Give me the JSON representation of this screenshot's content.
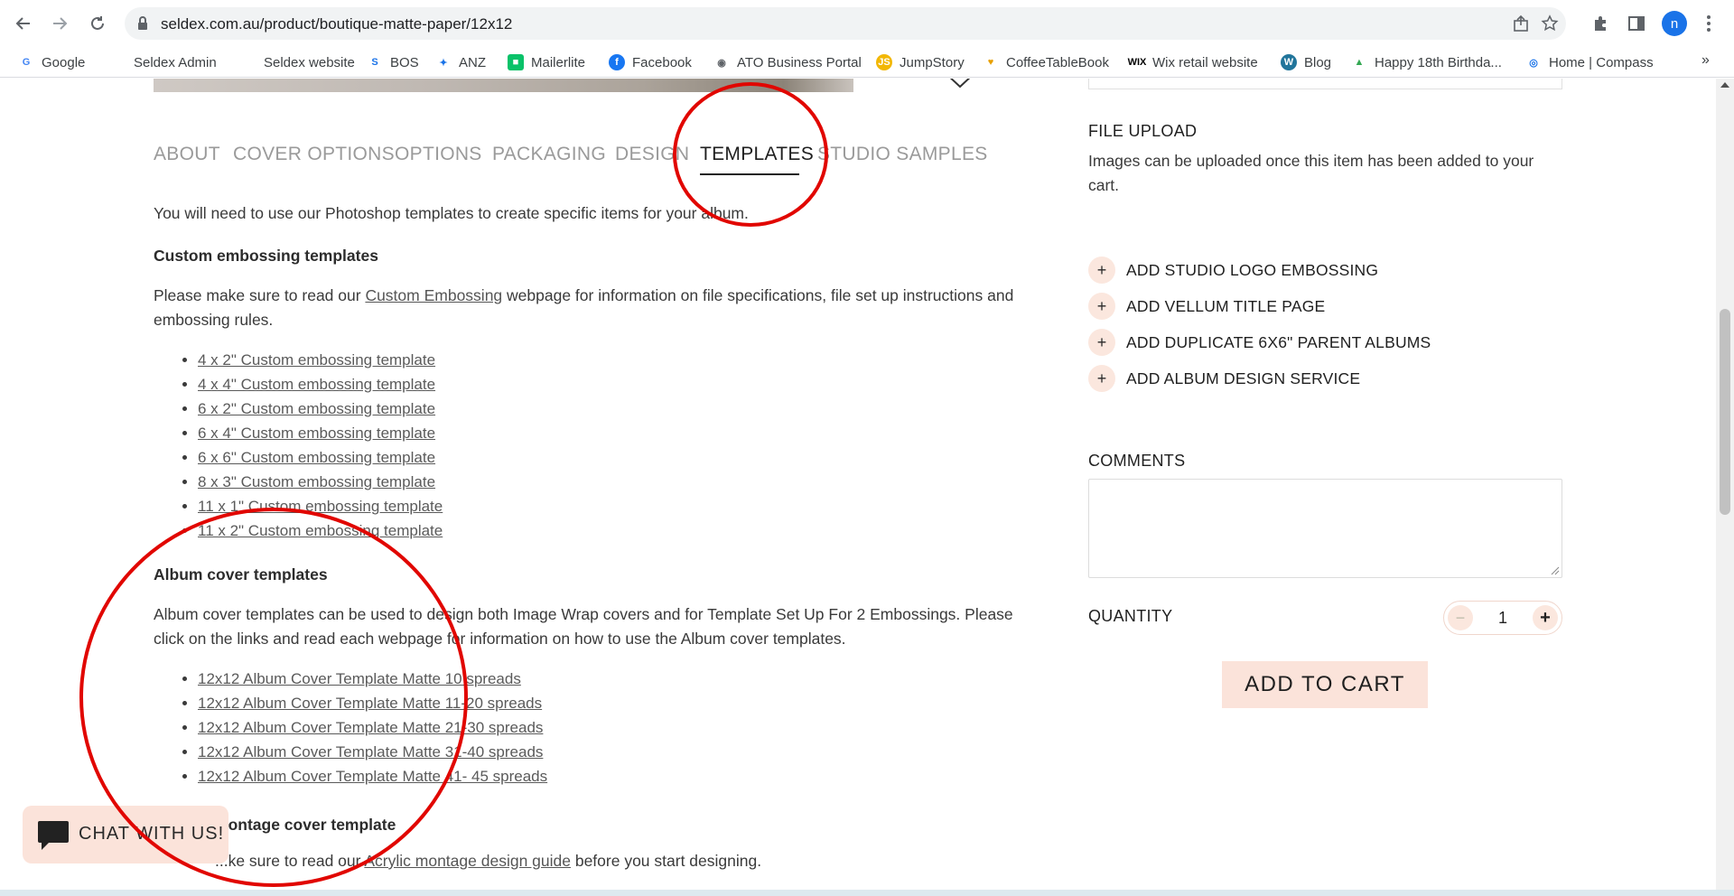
{
  "browser": {
    "url": "seldex.com.au/product/boutique-matte-paper/12x12",
    "profile_initial": "n",
    "bookmarks": [
      {
        "label": "Google",
        "icon": "google-icon",
        "color": "#4285f4"
      },
      {
        "label": "Seldex Admin",
        "icon": "blank-page-icon",
        "color": "#ffffff"
      },
      {
        "label": "Seldex website",
        "icon": "blank-page-icon",
        "color": "#ffffff"
      },
      {
        "label": "BOS",
        "icon": "bos-icon",
        "color": "#1a73e8"
      },
      {
        "label": "ANZ",
        "icon": "anz-icon",
        "color": "#1a73e8"
      },
      {
        "label": "Mailerlite",
        "icon": "mailerlite-icon",
        "color": "#09c269"
      },
      {
        "label": "Facebook",
        "icon": "facebook-icon",
        "color": "#1877f2"
      },
      {
        "label": "ATO Business Portal",
        "icon": "globe-icon",
        "color": "#5f6368"
      },
      {
        "label": "JumpStory",
        "icon": "jumpstory-icon",
        "color": "#f2b705"
      },
      {
        "label": "CoffeeTableBook",
        "icon": "heart-icon",
        "color": "#e8a000"
      },
      {
        "label": "Wix retail website",
        "icon": "wix-icon",
        "color": "#000000"
      },
      {
        "label": "Blog",
        "icon": "wordpress-icon",
        "color": "#21759b"
      },
      {
        "label": "Happy 18th Birthda...",
        "icon": "drive-icon",
        "color": "#34a853"
      },
      {
        "label": "Home | Compass",
        "icon": "compass-icon",
        "color": "#1a73e8"
      }
    ],
    "more_label": "»"
  },
  "tabs": [
    {
      "label": "ABOUT"
    },
    {
      "label": "COVER OPTIONS"
    },
    {
      "label": "OPTIONS"
    },
    {
      "label": "PACKAGING"
    },
    {
      "label": "DESIGN"
    },
    {
      "label": "TEMPLATES"
    },
    {
      "label": "STUDIO SAMPLES"
    }
  ],
  "active_tab": "TEMPLATES",
  "content": {
    "intro": "You will need to use our Photoshop templates to create specific items for your album.",
    "embossing": {
      "heading": "Custom embossing templates",
      "text_before": "Please make sure to read our ",
      "link": "Custom Embossing",
      "text_after": " webpage for information on file specifications, file set up instructions and embossing rules.",
      "items": [
        "4 x 2\" Custom embossing template",
        "4 x 4\" Custom embossing template",
        "6 x 2\" Custom embossing template",
        "6 x 4\" Custom embossing template",
        "6 x 6\" Custom embossing template",
        "8 x 3\" Custom embossing template",
        "11 x 1\" Custom embossing template",
        "11 x 2\" Custom embossing template"
      ]
    },
    "cover": {
      "heading": "Album cover templates",
      "text": "Album cover templates can be used to design both Image Wrap covers and for Template Set Up For 2 Embossings.  Please click on the links and read each webpage for information on how to use the Album cover templates.",
      "items": [
        "12x12 Album Cover Template Matte 10 spreads",
        "12x12 Album Cover Template Matte 11-20 spreads",
        "12x12 Album Cover Template Matte 21-30 spreads",
        "12x12 Album Cover Template Matte 31-40 spreads",
        "12x12 Album Cover Template Matte 41- 45 spreads"
      ]
    },
    "montage": {
      "heading": "...ontage cover template",
      "text_before": "...ke sure to read our ",
      "link": "Acrylic montage design guide",
      "text_after": " before you start designing."
    }
  },
  "sidebar": {
    "file_upload_label": "FILE UPLOAD",
    "file_upload_note": "Images can be uploaded once this item has been added to your cart.",
    "addons": [
      {
        "label": "ADD STUDIO LOGO EMBOSSING"
      },
      {
        "label": "ADD VELLUM TITLE PAGE"
      },
      {
        "label": "ADD DUPLICATE 6X6\" PARENT ALBUMS"
      },
      {
        "label": "ADD ALBUM DESIGN SERVICE"
      }
    ],
    "comments_label": "COMMENTS",
    "quantity_label": "QUANTITY",
    "quantity_value": "1",
    "add_to_cart": "ADD TO CART"
  },
  "chat": {
    "label": "CHAT WITH US!"
  },
  "colors": {
    "accent_pink": "#fbe3da",
    "annotation_red": "#e10600",
    "tab_inactive": "#9a9a9a"
  }
}
